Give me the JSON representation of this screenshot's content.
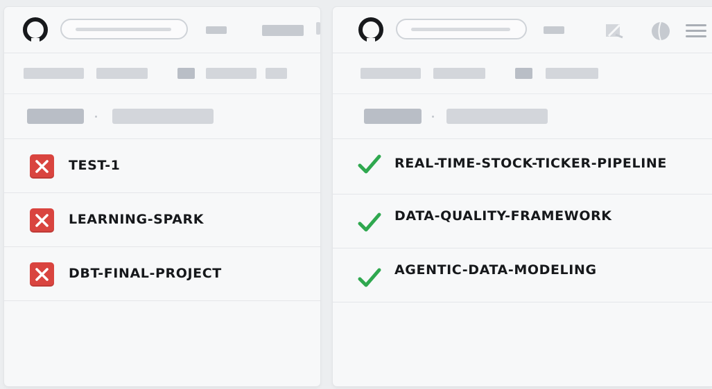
{
  "panels": [
    {
      "repos": [
        {
          "name": "TEST-1",
          "status": "failed"
        },
        {
          "name": "LEARNING-SPARK",
          "status": "failed"
        },
        {
          "name": "DBT-FINAL-PROJECT",
          "status": "failed"
        }
      ]
    },
    {
      "repos": [
        {
          "name": "REAL-TIME-STOCK-TICKER-PIPELINE",
          "status": "passed"
        },
        {
          "name": "DATA-QUALITY-FRAMEWORK",
          "status": "passed"
        },
        {
          "name": "AGENTIC-DATA-MODELING",
          "status": "passed"
        }
      ]
    }
  ],
  "colors": {
    "failed": "#d9443f",
    "passed": "#2fa84f"
  },
  "icons": {
    "failed": "x-mark-icon",
    "passed": "checkmark-icon",
    "logo": "github-logo-icon"
  }
}
